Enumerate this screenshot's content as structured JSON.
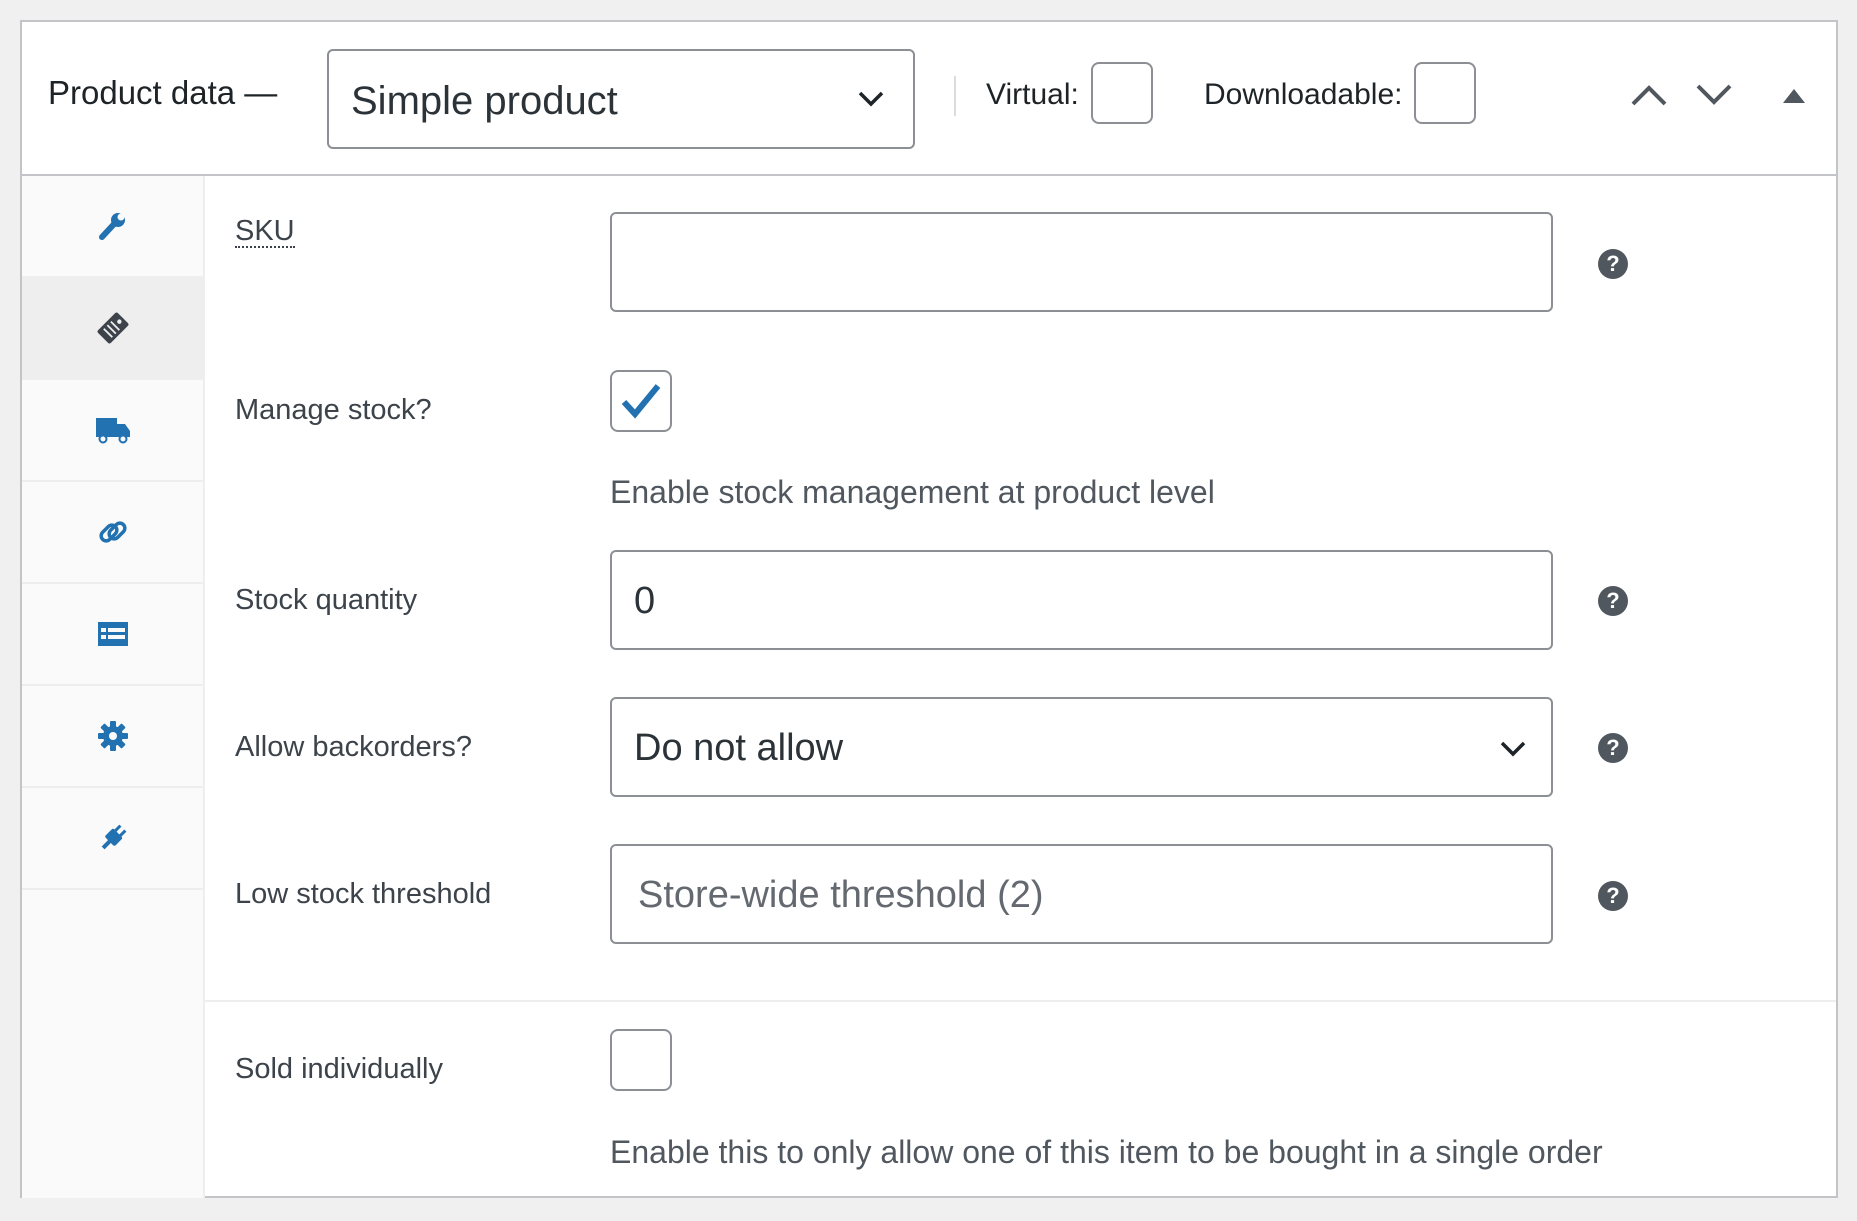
{
  "header": {
    "title": "Product data —",
    "product_type": "Simple product",
    "virtual_label": "Virtual:",
    "downloadable_label": "Downloadable:",
    "virtual_checked": false,
    "downloadable_checked": false
  },
  "sidebar": {
    "tabs": [
      {
        "icon": "wrench-icon",
        "active": false
      },
      {
        "icon": "tag-icon",
        "active": true
      },
      {
        "icon": "truck-icon",
        "active": false
      },
      {
        "icon": "link-icon",
        "active": false
      },
      {
        "icon": "list-icon",
        "active": false
      },
      {
        "icon": "gear-icon",
        "active": false
      },
      {
        "icon": "plug-icon",
        "active": false
      }
    ]
  },
  "inventory": {
    "sku": {
      "label": "SKU",
      "value": ""
    },
    "manage_stock": {
      "label": "Manage stock?",
      "checked": true,
      "description": "Enable stock management at product level"
    },
    "stock_quantity": {
      "label": "Stock quantity",
      "value": "0"
    },
    "backorders": {
      "label": "Allow backorders?",
      "value": "Do not allow"
    },
    "low_stock": {
      "label": "Low stock threshold",
      "placeholder": "Store-wide threshold (2)"
    },
    "sold_individually": {
      "label": "Sold individually",
      "checked": false,
      "description": "Enable this to only allow one of this item to be bought in a single order"
    },
    "help_glyph": "?"
  },
  "colors": {
    "accent": "#2271b1",
    "border": "#8c8f94",
    "help": "#50575e"
  }
}
